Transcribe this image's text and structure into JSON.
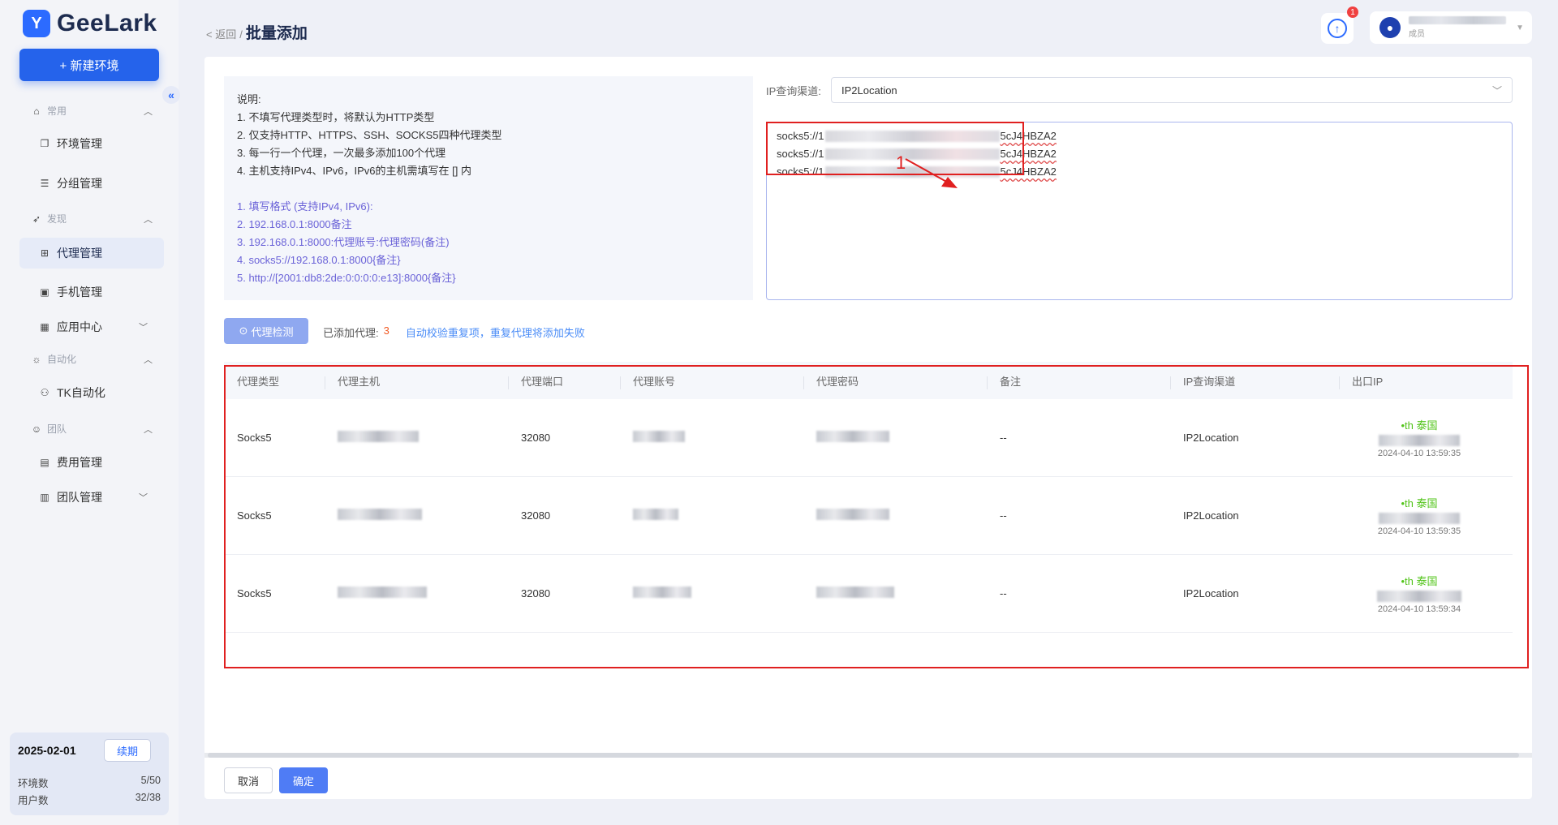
{
  "brand": {
    "name": "GeeLark"
  },
  "sidebar": {
    "new_env_label": "+ 新建环境",
    "groups": {
      "common": "常用",
      "discover": "发现",
      "automation": "自动化",
      "team": "团队"
    },
    "items": {
      "env_manage": "环境管理",
      "group_manage": "分组管理",
      "proxy_manage": "代理管理",
      "phone_manage": "手机管理",
      "app_center": "应用中心",
      "tk_automation": "TK自动化",
      "billing": "费用管理",
      "team_manage": "团队管理"
    },
    "plan": {
      "date": "2025-02-01",
      "renew_label": "续期",
      "env_count_label": "环境数",
      "env_count_value": "5/50",
      "user_count_label": "用户数",
      "user_count_value": "32/38"
    }
  },
  "header": {
    "back_label": "< 返回",
    "separator": "/",
    "title": "批量添加",
    "notification_count": "1",
    "user_role": "成员"
  },
  "instructions": {
    "heading": "说明:",
    "rules": [
      "1. 不填写代理类型时，将默认为HTTP类型",
      "2. 仅支持HTTP、HTTPS、SSH、SOCKS5四种代理类型",
      "3. 每一行一个代理，一次最多添加100个代理",
      "4. 主机支持IPv4、IPv6，IPv6的主机需填写在 [] 内"
    ],
    "formats": [
      "1. 填写格式 (支持IPv4, IPv6):",
      "2. 192.168.0.1:8000备注",
      "3. 192.168.0.1:8000:代理账号:代理密码(备注)",
      "4. socks5://192.168.0.1:8000{备注}",
      "5. http://[2001:db8:2de:0:0:0:0:e13]:8000{备注}"
    ]
  },
  "ip_channel": {
    "label": "IP查询渠道:",
    "value": "IP2Location"
  },
  "proxy_input": {
    "lines": [
      {
        "prefix": "socks5://1",
        "suffix": "5cJ4HBZA2"
      },
      {
        "prefix": "socks5://1",
        "suffix": "5cJ4HBZA2"
      },
      {
        "prefix": "socks5://1",
        "suffix": "5cJ4HBZA2"
      }
    ]
  },
  "annotation": {
    "number": "1",
    "color": "#e02020"
  },
  "actions": {
    "check_label": "代理检测",
    "added_label": "已添加代理:",
    "added_count": "3",
    "added_tip": "自动校验重复项，重复代理将添加失败"
  },
  "table": {
    "headers": [
      "代理类型",
      "代理主机",
      "代理端口",
      "代理账号",
      "代理密码",
      "备注",
      "IP查询渠道",
      "出口IP"
    ],
    "rows": [
      {
        "type": "Socks5",
        "port": "32080",
        "note": "--",
        "channel": "IP2Location",
        "country": "•th 泰国",
        "time": "2024-04-10 13:59:35"
      },
      {
        "type": "Socks5",
        "port": "32080",
        "note": "--",
        "channel": "IP2Location",
        "country": "•th 泰国",
        "time": "2024-04-10 13:59:35"
      },
      {
        "type": "Socks5",
        "port": "32080",
        "note": "--",
        "channel": "IP2Location",
        "country": "•th 泰国",
        "time": "2024-04-10 13:59:34"
      }
    ]
  },
  "footer": {
    "cancel_label": "取消",
    "confirm_label": "确定"
  },
  "colors": {
    "primary": "#2563eb",
    "success": "#52c41a",
    "warning": "#f15a24",
    "annotation": "#e02020"
  }
}
